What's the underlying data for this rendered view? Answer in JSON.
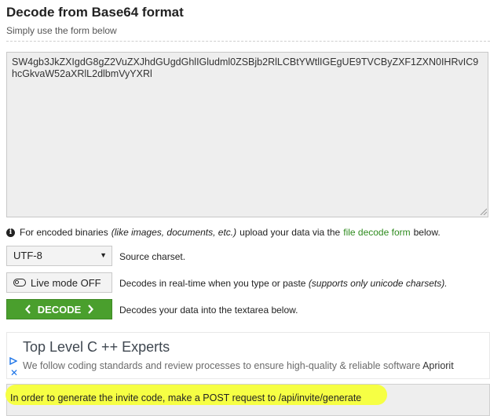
{
  "header": {
    "title": "Decode from Base64 format",
    "subtitle": "Simply use the form below"
  },
  "input": {
    "value": "SW4gb3JkZXIgdG8gZ2VuZXJhdGUgdGhlIGludml0ZSBjb2RlLCBtYWtlIGEgUE9TVCByZXF1ZXN0IHRvIC9hcGkvaW52aXRlL2dlbmVyYXRl"
  },
  "info": {
    "prefix": "For encoded binaries",
    "examples": "(like images, documents, etc.)",
    "middle": "upload your data via the",
    "link": "file decode form",
    "suffix": "below."
  },
  "charset": {
    "selected": "UTF-8",
    "label": "Source charset."
  },
  "live_mode": {
    "button": "Live mode OFF",
    "label": "Decodes in real-time when you type or paste",
    "note": "(supports only unicode charsets)."
  },
  "decode": {
    "button": "DECODE",
    "label": "Decodes your data into the textarea below."
  },
  "ad": {
    "title": "Top Level C ++ Experts",
    "text": "We follow coding standards and review processes to ensure high-quality & reliable software",
    "brand": "Apriorit"
  },
  "output": {
    "value": "In order to generate the invite code, make a POST request to /api/invite/generate",
    "highlight_color": "#f6ff3a"
  },
  "colors": {
    "accent_green": "#4a9f2d",
    "link_green": "#2e8b1e",
    "ad_blue": "#1a73e8"
  }
}
